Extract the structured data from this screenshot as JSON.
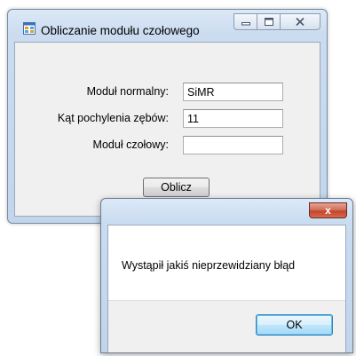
{
  "main_window": {
    "title": "Obliczanie modułu czołowego",
    "icon": "windows-form-icon",
    "buttons": {
      "minimize": "minimize-icon",
      "maximize": "maximize-icon",
      "close": "close-icon"
    },
    "fields": [
      {
        "label": "Moduł normalny:",
        "value": "SiMR"
      },
      {
        "label": "Kąt pochylenia zębów:",
        "value": "11"
      },
      {
        "label": "Moduł czołowy:",
        "value": ""
      }
    ],
    "compute_button": "Oblicz"
  },
  "dialog": {
    "title": "",
    "close_glyph": "x",
    "message": "Wystąpił jakiś nieprzewidziany błąd",
    "ok_button": "OK"
  }
}
